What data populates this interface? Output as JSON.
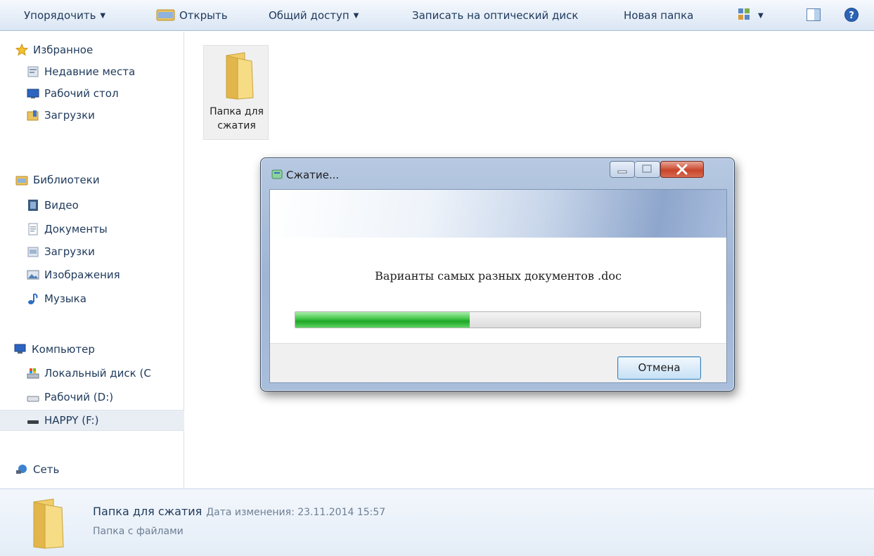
{
  "toolbar": {
    "organize": "Упорядочить",
    "open": "Открыть",
    "share": "Общий доступ",
    "burn": "Записать на оптический диск",
    "new_folder": "Новая папка",
    "view_icon": "view-options-icon",
    "pane_icon": "preview-pane-icon",
    "help_icon": "help-icon"
  },
  "nav": {
    "items": [
      {
        "label": "Избранное",
        "icon": "star-icon"
      },
      {
        "label": "Недавние места",
        "icon": "recent-places-icon"
      },
      {
        "label": "Рабочий стол",
        "icon": "desktop-icon"
      },
      {
        "label": "Загрузки",
        "icon": "downloads-folder-icon"
      },
      {
        "label": "Библиотеки",
        "icon": "libraries-icon"
      },
      {
        "label": "Видео",
        "icon": "video-icon"
      },
      {
        "label": "Документы",
        "icon": "documents-icon"
      },
      {
        "label": "Загрузки",
        "icon": "downloads-library-icon"
      },
      {
        "label": "Изображения",
        "icon": "pictures-icon"
      },
      {
        "label": "Музыка",
        "icon": "music-icon"
      },
      {
        "label": "Компьютер",
        "icon": "computer-icon"
      },
      {
        "label": "Локальный диск (С",
        "icon": "local-disk-icon"
      },
      {
        "label": "Рабочий (D:)",
        "icon": "drive-icon"
      },
      {
        "label": "HAPPY (F:)",
        "icon": "usb-drive-icon"
      },
      {
        "label": "Сеть",
        "icon": "network-icon"
      }
    ]
  },
  "content": {
    "folder_label": "Папка для сжатия"
  },
  "details": {
    "name": "Папка для сжатия",
    "modified": "Дата изменения: 23.11.2014 15:57",
    "type": "Папка с файлами"
  },
  "dialog": {
    "title": "Сжатие...",
    "filename": "Варианты самых разных документов .doc",
    "progress": 0.43,
    "cancel": "Отмена"
  },
  "colors": {
    "progress_green": "#2fb836",
    "close_red": "#c8452b",
    "accent_blue": "#1e395b"
  }
}
